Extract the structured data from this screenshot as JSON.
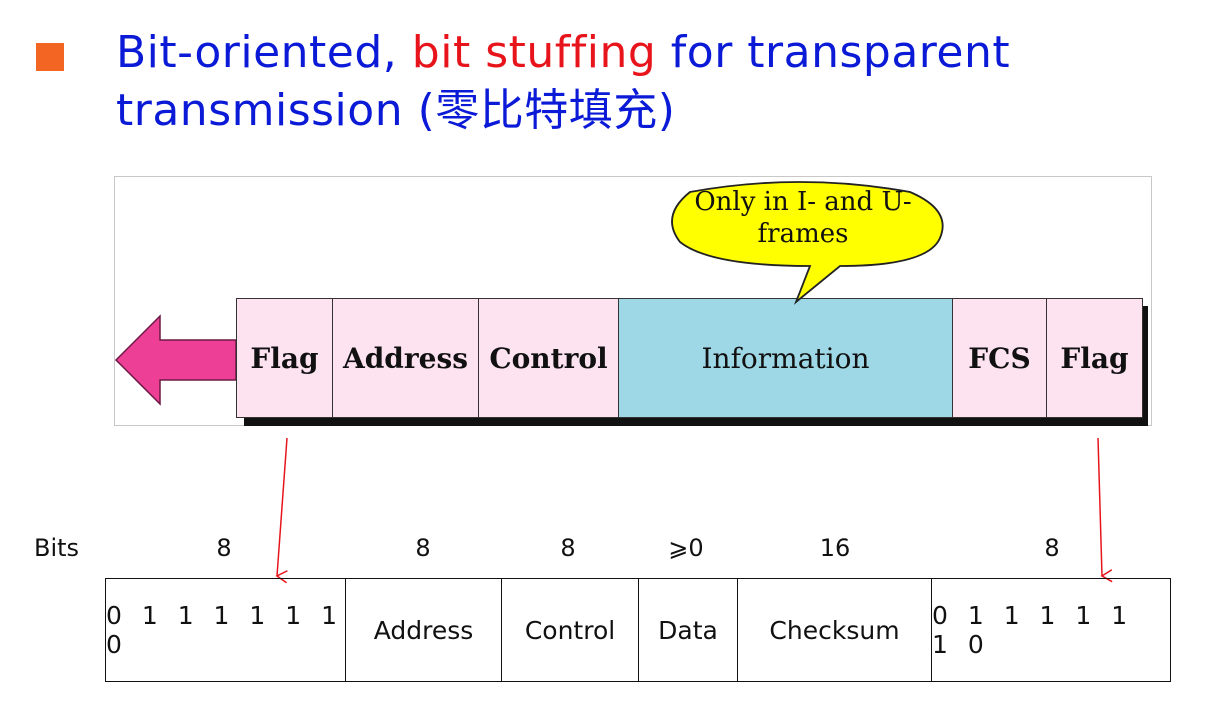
{
  "heading": {
    "part1": "Bit-oriented,",
    "part2_red": "bit stuffing",
    "part3": "for transparent",
    "part4": "transmission",
    "part5_paren": "(零比特填充)"
  },
  "colors": {
    "bullet": "#f26522",
    "heading_blue": "#0a1ad6",
    "heading_red": "#e8141c",
    "frame_pink": "#fde2ef",
    "info_blue": "#9ed8e6",
    "callout_yellow": "#ffff00",
    "direction_arrow": "#ee3f96",
    "pointer_red": "#e8141c"
  },
  "frame": {
    "callout": [
      "Only in I- and U-",
      "frames"
    ],
    "fields": [
      "Flag",
      "Address",
      "Control",
      "Information",
      "FCS",
      "Flag"
    ]
  },
  "bits": {
    "label": "Bits",
    "counts": [
      "8",
      "8",
      "8",
      "⩾0",
      "16",
      "8"
    ],
    "fields": [
      "0 1 1 1 1 1 1 0",
      "Address",
      "Control",
      "Data",
      "Checksum",
      "0 1 1 1 1 1 1 0"
    ]
  }
}
